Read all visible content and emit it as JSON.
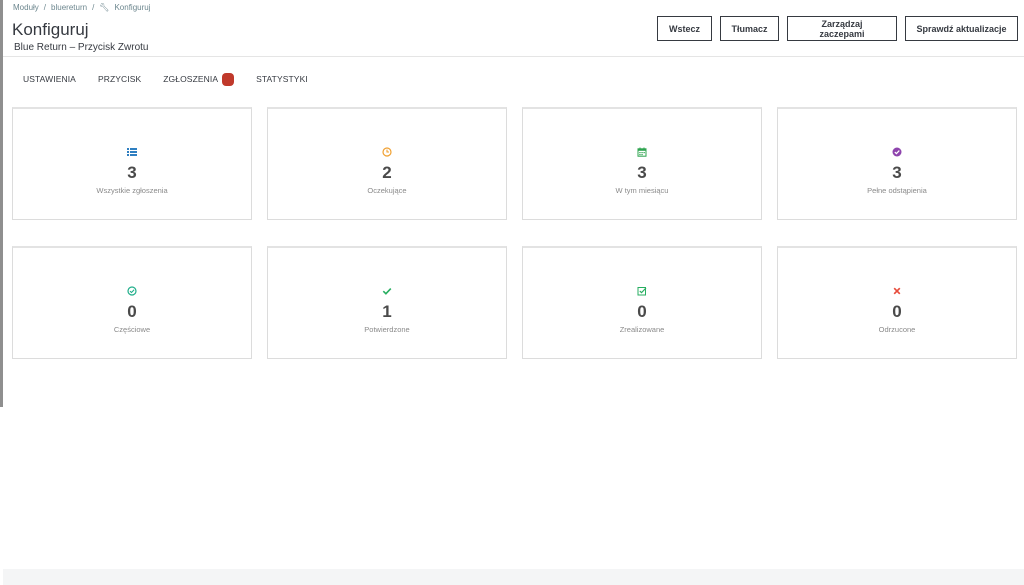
{
  "breadcrumb": {
    "items": [
      "Moduły",
      "bluereturn",
      "Konfiguruj"
    ]
  },
  "header": {
    "title": "Konfiguruj",
    "subtitle": "Blue Return – Przycisk Zwrotu"
  },
  "toolbar": {
    "back_label": "Wstecz",
    "translate_label": "Tłumacz",
    "hooks_label": "Zarządzaj zaczepami",
    "update_label": "Sprawdź aktualizacje"
  },
  "tabs": [
    {
      "label": "USTAWIENIA"
    },
    {
      "label": "PRZYCISK"
    },
    {
      "label": "ZGŁOSZENIA"
    },
    {
      "label": "STATYSTYKI"
    }
  ],
  "stats": [
    {
      "icon": "list-icon",
      "color": "#2f7fc1",
      "value": "3",
      "label": "Wszystkie zgłoszenia"
    },
    {
      "icon": "clock-icon",
      "color": "#f0a030",
      "value": "2",
      "label": "Oczekujące"
    },
    {
      "icon": "calendar-icon",
      "color": "#2ea44f",
      "value": "3",
      "label": "W tym miesiącu"
    },
    {
      "icon": "check-circle-icon",
      "color": "#8e44ad",
      "value": "3",
      "label": "Pełne odstąpienia"
    },
    {
      "icon": "check-circle-outline-icon",
      "color": "#1fae8a",
      "value": "0",
      "label": "Częściowe"
    },
    {
      "icon": "check-icon",
      "color": "#27ae60",
      "value": "1",
      "label": "Potwierdzone"
    },
    {
      "icon": "check-square-icon",
      "color": "#27ae60",
      "value": "0",
      "label": "Zrealizowane"
    },
    {
      "icon": "x-icon",
      "color": "#e74c3c",
      "value": "0",
      "label": "Odrzucone"
    }
  ]
}
